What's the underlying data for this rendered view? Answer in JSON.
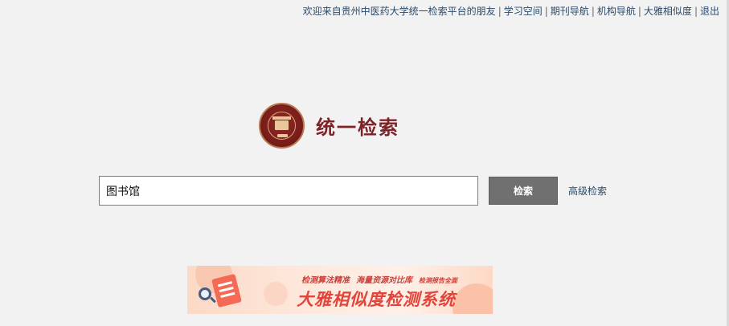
{
  "topbar": {
    "welcome": "欢迎来自贵州中医药大学统一检索平台的朋友",
    "links": [
      "学习空间",
      "期刊导航",
      "机构导航",
      "大雅相似度",
      "退出"
    ],
    "separator": "|"
  },
  "brand": {
    "logo_icon": "university-seal-icon",
    "title": "统一检索"
  },
  "search": {
    "value": "图书馆",
    "button_label": "检索",
    "advanced_label": "高级检索"
  },
  "banner": {
    "tagline_1": "检测算法精准",
    "tagline_2": "海量资源对比库",
    "tagline_3": "检测报告全面",
    "headline": "大雅相似度检测系统",
    "icon": "document-magnifier-icon"
  },
  "colors": {
    "background": "#f2f2f2",
    "link": "#2a4a6b",
    "brand": "#7c2327",
    "button": "#707070",
    "banner_accent": "#e2443a"
  }
}
